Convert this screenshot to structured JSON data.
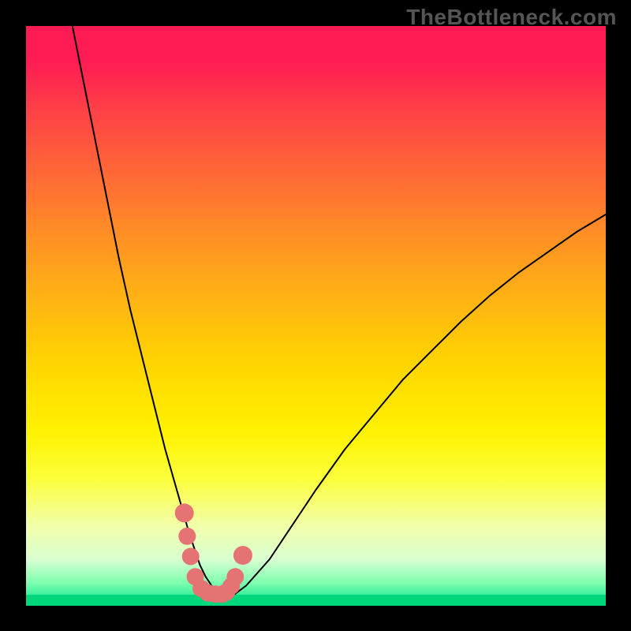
{
  "watermark": "TheBottleneck.com",
  "chart_data": {
    "type": "line",
    "title": "",
    "xlabel": "",
    "ylabel": "",
    "xlim": [
      0,
      100
    ],
    "ylim": [
      0,
      100
    ],
    "grid": false,
    "legend": null,
    "series": [
      {
        "name": "bottleneck-curve",
        "x": [
          8,
          10,
          12,
          14,
          16,
          18,
          20,
          22,
          24,
          26,
          28,
          29,
          30,
          31,
          32,
          33,
          34,
          36,
          38,
          42,
          46,
          50,
          55,
          60,
          65,
          70,
          75,
          80,
          85,
          90,
          95,
          100
        ],
        "y": [
          100,
          90,
          80,
          70,
          60,
          51,
          43,
          35,
          27,
          20,
          13,
          10,
          7,
          5,
          3.5,
          2.5,
          2,
          2,
          3.5,
          8,
          14,
          20,
          27,
          33,
          39,
          44,
          49,
          53.5,
          57.5,
          61,
          64.5,
          67.5
        ]
      }
    ],
    "markers": {
      "note": "salmon dots cluster near curve minimum (approx x 27–37)",
      "points": [
        {
          "x": 27.3,
          "y": 16
        },
        {
          "x": 27.8,
          "y": 12
        },
        {
          "x": 28.4,
          "y": 8.5
        },
        {
          "x": 29.2,
          "y": 5
        },
        {
          "x": 30.2,
          "y": 3
        },
        {
          "x": 31.4,
          "y": 2.2
        },
        {
          "x": 32.7,
          "y": 2
        },
        {
          "x": 33.8,
          "y": 2
        },
        {
          "x": 34.6,
          "y": 2.4
        },
        {
          "x": 35.4,
          "y": 3.4
        },
        {
          "x": 36.1,
          "y": 5
        },
        {
          "x": 37.4,
          "y": 8.7
        }
      ]
    },
    "background_gradient": {
      "top": "#ff1c54",
      "mid": "#ffe500",
      "bottom": "#00e58b"
    }
  }
}
